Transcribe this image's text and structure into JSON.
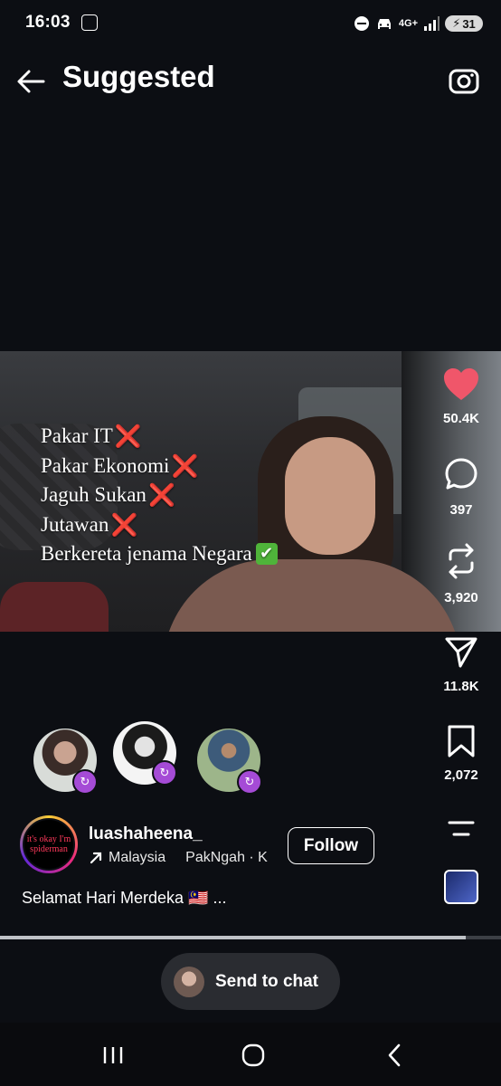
{
  "status_bar": {
    "time": "16:03",
    "network": "4G+",
    "battery": "31",
    "icons": [
      "touch-n-go-icon",
      "do-not-disturb-icon",
      "car-mode-icon",
      "signal-icon",
      "battery-charging-icon"
    ]
  },
  "header": {
    "title": "Suggested",
    "back_icon": "arrow-left-icon",
    "camera_icon": "camera-icon"
  },
  "video": {
    "overlay_lines": [
      {
        "text": "Pakar IT",
        "mark": "❌"
      },
      {
        "text": "Pakar Ekonomi",
        "mark": "❌"
      },
      {
        "text": "Jaguh Sukan",
        "mark": "❌"
      },
      {
        "text": "Jutawan",
        "mark": "❌"
      },
      {
        "text": "Berkereta jenama Negara",
        "mark": "✔"
      }
    ]
  },
  "actions": {
    "likes": "50.4K",
    "comments": "397",
    "reposts": "3,920",
    "shares": "11.8K",
    "saves": "2,072"
  },
  "account": {
    "avatar_text_line1": "it's okay I'm",
    "avatar_text_line2": "spiderman",
    "username": "luashaheena_",
    "location": "Malaysia",
    "audio": "PakNgah · K",
    "follow_label": "Follow"
  },
  "caption": "Selamat Hari Merdeka 🇲🇾 ...",
  "progress": 0.93,
  "send_to_chat": {
    "label": "Send to chat"
  },
  "nav": {
    "icons": [
      "recent-apps-icon",
      "home-icon",
      "back-icon"
    ]
  },
  "colors": {
    "background": "#0c0e13",
    "like": "#f0566a",
    "badge": "#a54bd6"
  }
}
